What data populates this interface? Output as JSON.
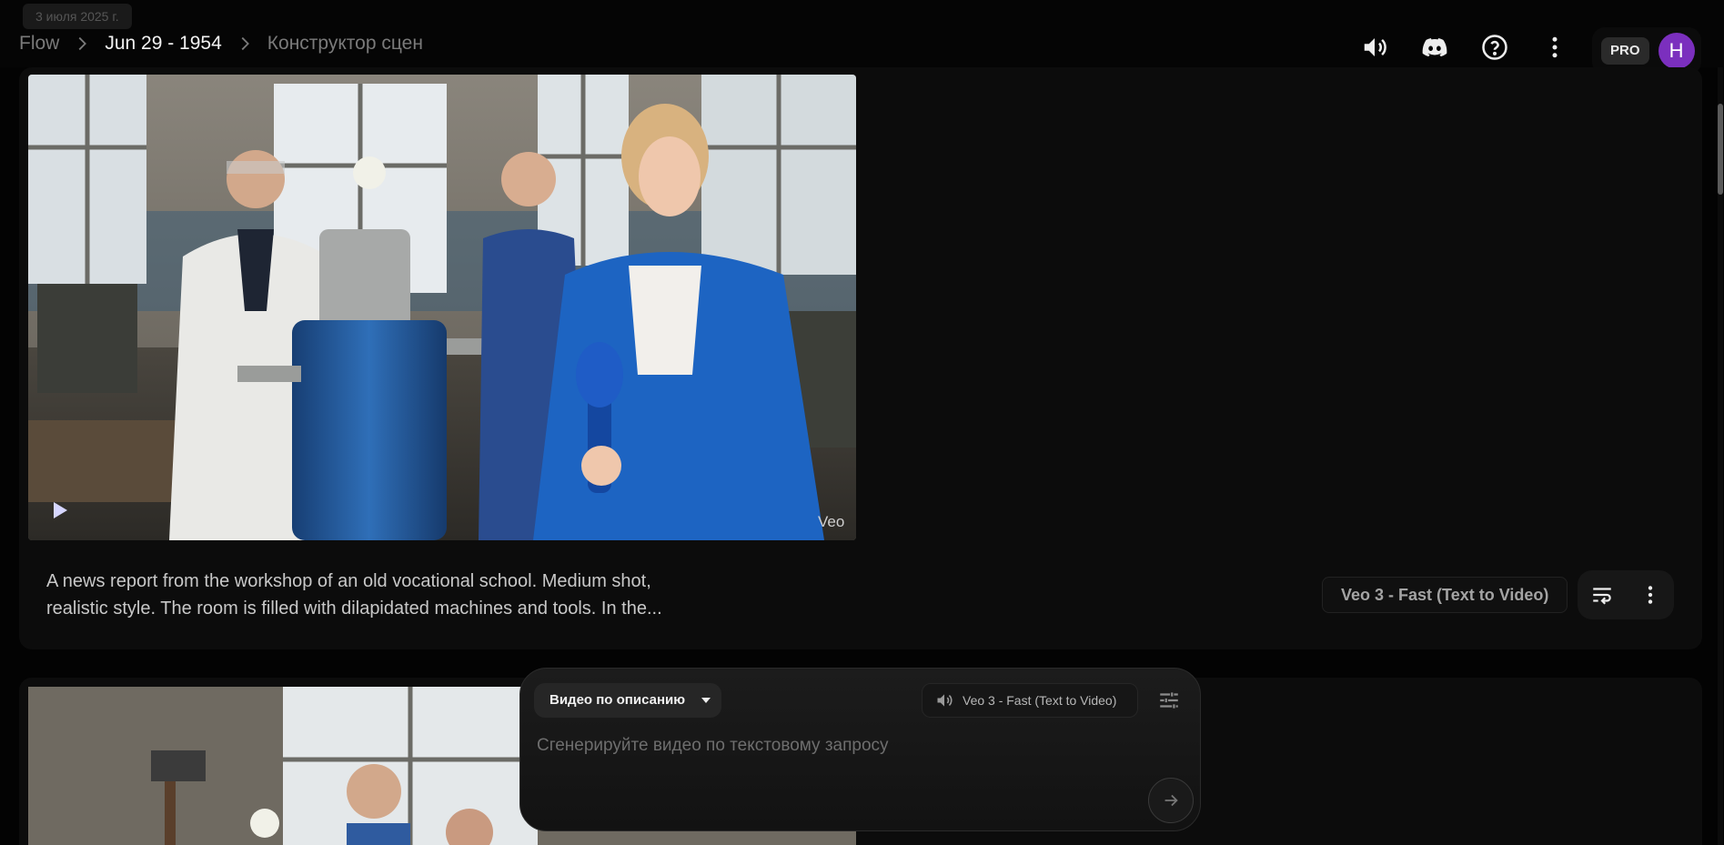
{
  "header": {
    "date_chip": "3 июля 2025 г.",
    "breadcrumb": {
      "root": "Flow",
      "project": "Jun 29 - 1954",
      "page": "Конструктор сцен"
    },
    "account": {
      "plan": "PRO",
      "avatar_letter": "H"
    },
    "icons": [
      "speaker-icon",
      "discord-icon",
      "help-icon",
      "more-vertical-icon"
    ]
  },
  "cards": [
    {
      "video_label": "Veo",
      "prompt": "A news report from the workshop of an old vocational school. Medium shot, realistic style. The room is filled with dilapidated machines and tools. In the...",
      "model": "Veo 3 - Fast (Text to Video)"
    }
  ],
  "composer": {
    "mode": "Видео по описанию",
    "model": "Veo 3 - Fast (Text to Video)",
    "placeholder": "Сгенерируйте видео по текстовому запросу"
  },
  "colors": {
    "background": "#030303",
    "card": "#0c0c0c",
    "avatar": "#7b2fbe",
    "blazer_blue": "#1d64c2"
  }
}
